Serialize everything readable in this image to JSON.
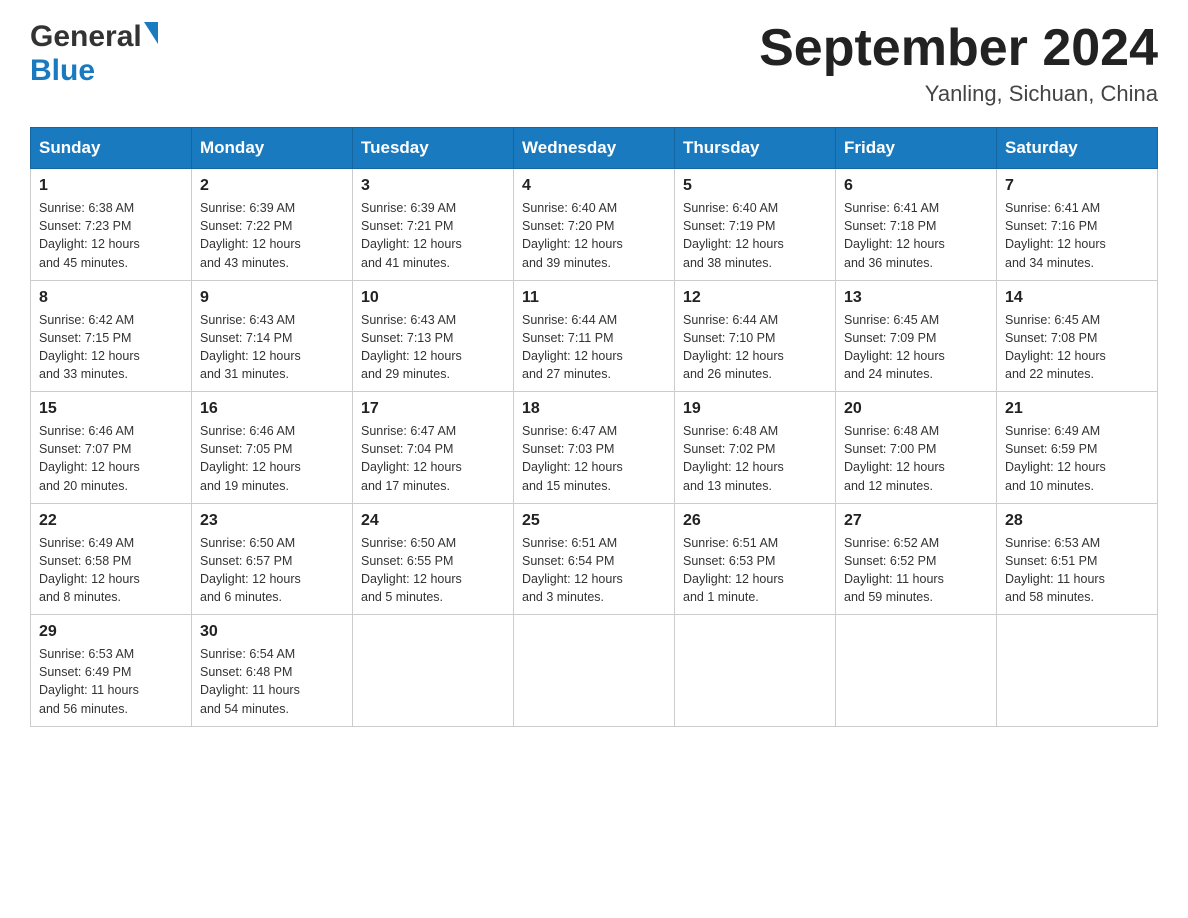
{
  "header": {
    "logo_general": "General",
    "logo_blue": "Blue",
    "calendar_title": "September 2024",
    "calendar_subtitle": "Yanling, Sichuan, China"
  },
  "weekdays": [
    "Sunday",
    "Monday",
    "Tuesday",
    "Wednesday",
    "Thursday",
    "Friday",
    "Saturday"
  ],
  "weeks": [
    [
      {
        "day": "1",
        "info": "Sunrise: 6:38 AM\nSunset: 7:23 PM\nDaylight: 12 hours\nand 45 minutes."
      },
      {
        "day": "2",
        "info": "Sunrise: 6:39 AM\nSunset: 7:22 PM\nDaylight: 12 hours\nand 43 minutes."
      },
      {
        "day": "3",
        "info": "Sunrise: 6:39 AM\nSunset: 7:21 PM\nDaylight: 12 hours\nand 41 minutes."
      },
      {
        "day": "4",
        "info": "Sunrise: 6:40 AM\nSunset: 7:20 PM\nDaylight: 12 hours\nand 39 minutes."
      },
      {
        "day": "5",
        "info": "Sunrise: 6:40 AM\nSunset: 7:19 PM\nDaylight: 12 hours\nand 38 minutes."
      },
      {
        "day": "6",
        "info": "Sunrise: 6:41 AM\nSunset: 7:18 PM\nDaylight: 12 hours\nand 36 minutes."
      },
      {
        "day": "7",
        "info": "Sunrise: 6:41 AM\nSunset: 7:16 PM\nDaylight: 12 hours\nand 34 minutes."
      }
    ],
    [
      {
        "day": "8",
        "info": "Sunrise: 6:42 AM\nSunset: 7:15 PM\nDaylight: 12 hours\nand 33 minutes."
      },
      {
        "day": "9",
        "info": "Sunrise: 6:43 AM\nSunset: 7:14 PM\nDaylight: 12 hours\nand 31 minutes."
      },
      {
        "day": "10",
        "info": "Sunrise: 6:43 AM\nSunset: 7:13 PM\nDaylight: 12 hours\nand 29 minutes."
      },
      {
        "day": "11",
        "info": "Sunrise: 6:44 AM\nSunset: 7:11 PM\nDaylight: 12 hours\nand 27 minutes."
      },
      {
        "day": "12",
        "info": "Sunrise: 6:44 AM\nSunset: 7:10 PM\nDaylight: 12 hours\nand 26 minutes."
      },
      {
        "day": "13",
        "info": "Sunrise: 6:45 AM\nSunset: 7:09 PM\nDaylight: 12 hours\nand 24 minutes."
      },
      {
        "day": "14",
        "info": "Sunrise: 6:45 AM\nSunset: 7:08 PM\nDaylight: 12 hours\nand 22 minutes."
      }
    ],
    [
      {
        "day": "15",
        "info": "Sunrise: 6:46 AM\nSunset: 7:07 PM\nDaylight: 12 hours\nand 20 minutes."
      },
      {
        "day": "16",
        "info": "Sunrise: 6:46 AM\nSunset: 7:05 PM\nDaylight: 12 hours\nand 19 minutes."
      },
      {
        "day": "17",
        "info": "Sunrise: 6:47 AM\nSunset: 7:04 PM\nDaylight: 12 hours\nand 17 minutes."
      },
      {
        "day": "18",
        "info": "Sunrise: 6:47 AM\nSunset: 7:03 PM\nDaylight: 12 hours\nand 15 minutes."
      },
      {
        "day": "19",
        "info": "Sunrise: 6:48 AM\nSunset: 7:02 PM\nDaylight: 12 hours\nand 13 minutes."
      },
      {
        "day": "20",
        "info": "Sunrise: 6:48 AM\nSunset: 7:00 PM\nDaylight: 12 hours\nand 12 minutes."
      },
      {
        "day": "21",
        "info": "Sunrise: 6:49 AM\nSunset: 6:59 PM\nDaylight: 12 hours\nand 10 minutes."
      }
    ],
    [
      {
        "day": "22",
        "info": "Sunrise: 6:49 AM\nSunset: 6:58 PM\nDaylight: 12 hours\nand 8 minutes."
      },
      {
        "day": "23",
        "info": "Sunrise: 6:50 AM\nSunset: 6:57 PM\nDaylight: 12 hours\nand 6 minutes."
      },
      {
        "day": "24",
        "info": "Sunrise: 6:50 AM\nSunset: 6:55 PM\nDaylight: 12 hours\nand 5 minutes."
      },
      {
        "day": "25",
        "info": "Sunrise: 6:51 AM\nSunset: 6:54 PM\nDaylight: 12 hours\nand 3 minutes."
      },
      {
        "day": "26",
        "info": "Sunrise: 6:51 AM\nSunset: 6:53 PM\nDaylight: 12 hours\nand 1 minute."
      },
      {
        "day": "27",
        "info": "Sunrise: 6:52 AM\nSunset: 6:52 PM\nDaylight: 11 hours\nand 59 minutes."
      },
      {
        "day": "28",
        "info": "Sunrise: 6:53 AM\nSunset: 6:51 PM\nDaylight: 11 hours\nand 58 minutes."
      }
    ],
    [
      {
        "day": "29",
        "info": "Sunrise: 6:53 AM\nSunset: 6:49 PM\nDaylight: 11 hours\nand 56 minutes."
      },
      {
        "day": "30",
        "info": "Sunrise: 6:54 AM\nSunset: 6:48 PM\nDaylight: 11 hours\nand 54 minutes."
      },
      {
        "day": "",
        "info": ""
      },
      {
        "day": "",
        "info": ""
      },
      {
        "day": "",
        "info": ""
      },
      {
        "day": "",
        "info": ""
      },
      {
        "day": "",
        "info": ""
      }
    ]
  ]
}
